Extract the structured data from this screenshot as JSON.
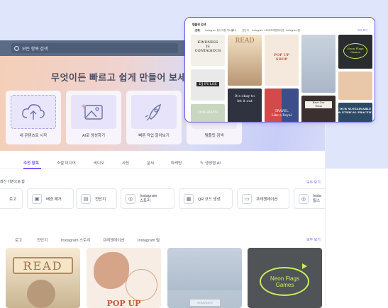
{
  "search": {
    "placeholder": "모든 항목 검색"
  },
  "hero": {
    "title": "무엇이든 빠르고 쉽게 만들어 보세",
    "tiles": [
      {
        "label": "내 콘텐츠로 시작",
        "icon": "upload-cloud-icon"
      },
      {
        "label": "AI로 생성하기",
        "icon": "image-sparkle-icon"
      },
      {
        "label": "빠른 작업 알아보기",
        "icon": "rocket-icon"
      },
      {
        "label": "템플릿 검색",
        "icon": "template-icon"
      }
    ]
  },
  "tabs": [
    "추천 항목",
    "소셜 미디어",
    "비디오",
    "사진",
    "문서",
    "마케팅",
    "생성형 AI"
  ],
  "quick_actions": {
    "title": "최신 기반으로 함",
    "more": "모두 보기",
    "chips": [
      {
        "label": "로고",
        "icon": "logo-icon"
      },
      {
        "label": "배경 제거",
        "icon": "remove-background-icon"
      },
      {
        "label": "전단지",
        "icon": "flyer-icon"
      },
      {
        "label": "Instagram\n스토리",
        "icon": "instagram-icon"
      },
      {
        "label": "QR 코드 생성",
        "icon": "qr-code-icon"
      },
      {
        "label": "프레젠테이션",
        "icon": "presentation-icon"
      },
      {
        "label": "Insta\n릴스",
        "icon": "instagram-icon"
      }
    ]
  },
  "template_filters": [
    "로고",
    "전단지",
    "Instagram 스토리",
    "프레젠테이션",
    "Instagram 릴"
  ],
  "templates_more": "모두 보기",
  "cards": [
    {
      "text": "READ"
    },
    {
      "text": "POP UP"
    },
    {
      "text": "REMINDER"
    },
    {
      "text": "Neon Flags\nGames"
    }
  ],
  "panel": {
    "title": "템플릿 검색",
    "more": "모두 보기",
    "tabs": [
      "전체",
      "Instagram 정사각형 게시물",
      "포스",
      "전단지",
      "Instagram 스토리",
      "프레젠테이션",
      "Instagram 릴"
    ],
    "thumbs": [
      {
        "text": "KINDNESS\nIS\nCONTAGIOUS"
      },
      {
        "text": "READ"
      },
      {
        "text": "POP UP\nSHOP"
      },
      {
        "text": ""
      },
      {
        "text": "Neon Flags\nGames"
      },
      {
        "text": "DJ PULSE"
      },
      {
        "text": "It's okay to\nlet it out"
      },
      {
        "text": "TRAVEL\nLike a Royal"
      },
      {
        "text": "Have Our\nTeam"
      },
      {
        "text": "OUR SUSTAINABLE\n& ETHICAL PRACTICES"
      },
      {
        "text": "CONGRATS!"
      }
    ]
  },
  "colors": {
    "accent": "#7b5cf5",
    "topbar": "#5b6b86"
  }
}
